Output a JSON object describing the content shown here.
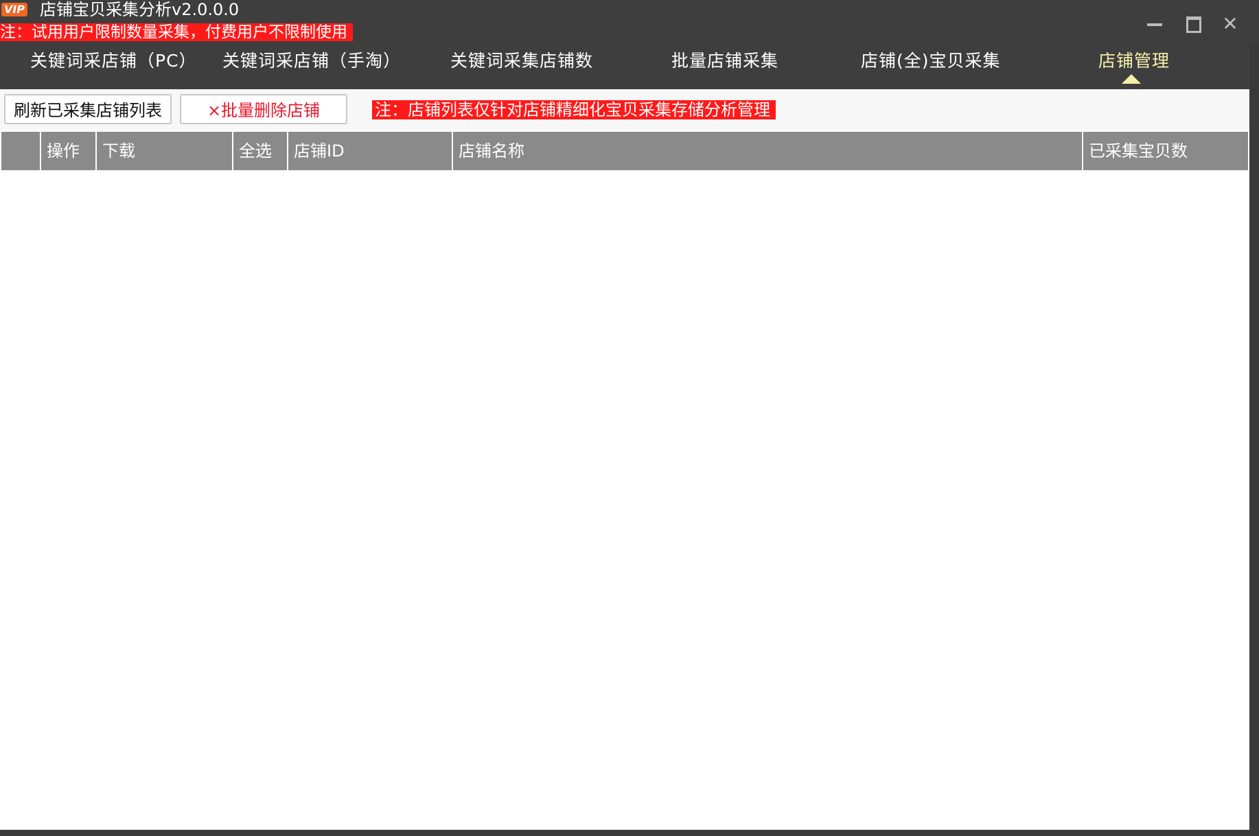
{
  "window": {
    "badge": "VIP",
    "title": "店铺宝贝采集分析v2.0.0.0",
    "trial_note": "注：试用用户限制数量采集，付费用户不限制使用"
  },
  "nav": {
    "tabs": [
      {
        "label": "关键词采店铺（PC）"
      },
      {
        "label": "关键词采店铺（手淘）"
      },
      {
        "label": "关键词采集店铺数"
      },
      {
        "label": "批量店铺采集"
      },
      {
        "label": "店铺(全)宝贝采集"
      },
      {
        "label": "店铺管理"
      }
    ],
    "active_index": 5
  },
  "toolbar": {
    "refresh_label": "刷新已采集店铺列表",
    "delete_label": "×批量删除店铺",
    "note": "注：店铺列表仅针对店铺精细化宝贝采集存储分析管理"
  },
  "table": {
    "columns": [
      "",
      "操作",
      "下载",
      "全选",
      "店铺ID",
      "店铺名称",
      "已采集宝贝数"
    ],
    "rows": []
  },
  "colors": {
    "titlebar_bg": "#3e3e3e",
    "active_tab": "#f5f0a8",
    "alert_red": "#ff1a1a",
    "header_gray": "#8a8a8a"
  }
}
